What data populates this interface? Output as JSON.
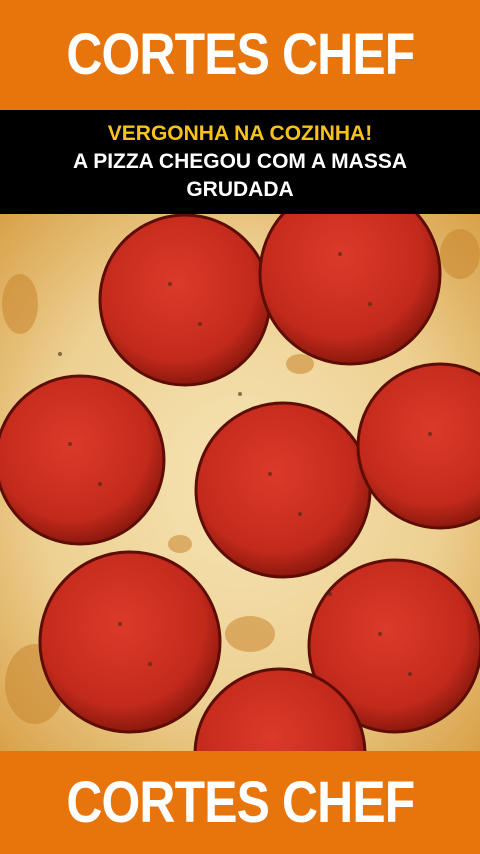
{
  "header": {
    "brand": "CORTES CHEF"
  },
  "headline": {
    "line1": "VERGONHA NA COZINHA!",
    "line2": "A PIZZA CHEGOU COM A MASSA GRUDADA"
  },
  "footer": {
    "brand": "CORTES CHEF"
  },
  "colors": {
    "orange": "#e8740c",
    "yellow": "#f7c21c",
    "black": "#000000",
    "cheese": "#f0d9a0",
    "pepperoni": "#c8281e"
  }
}
